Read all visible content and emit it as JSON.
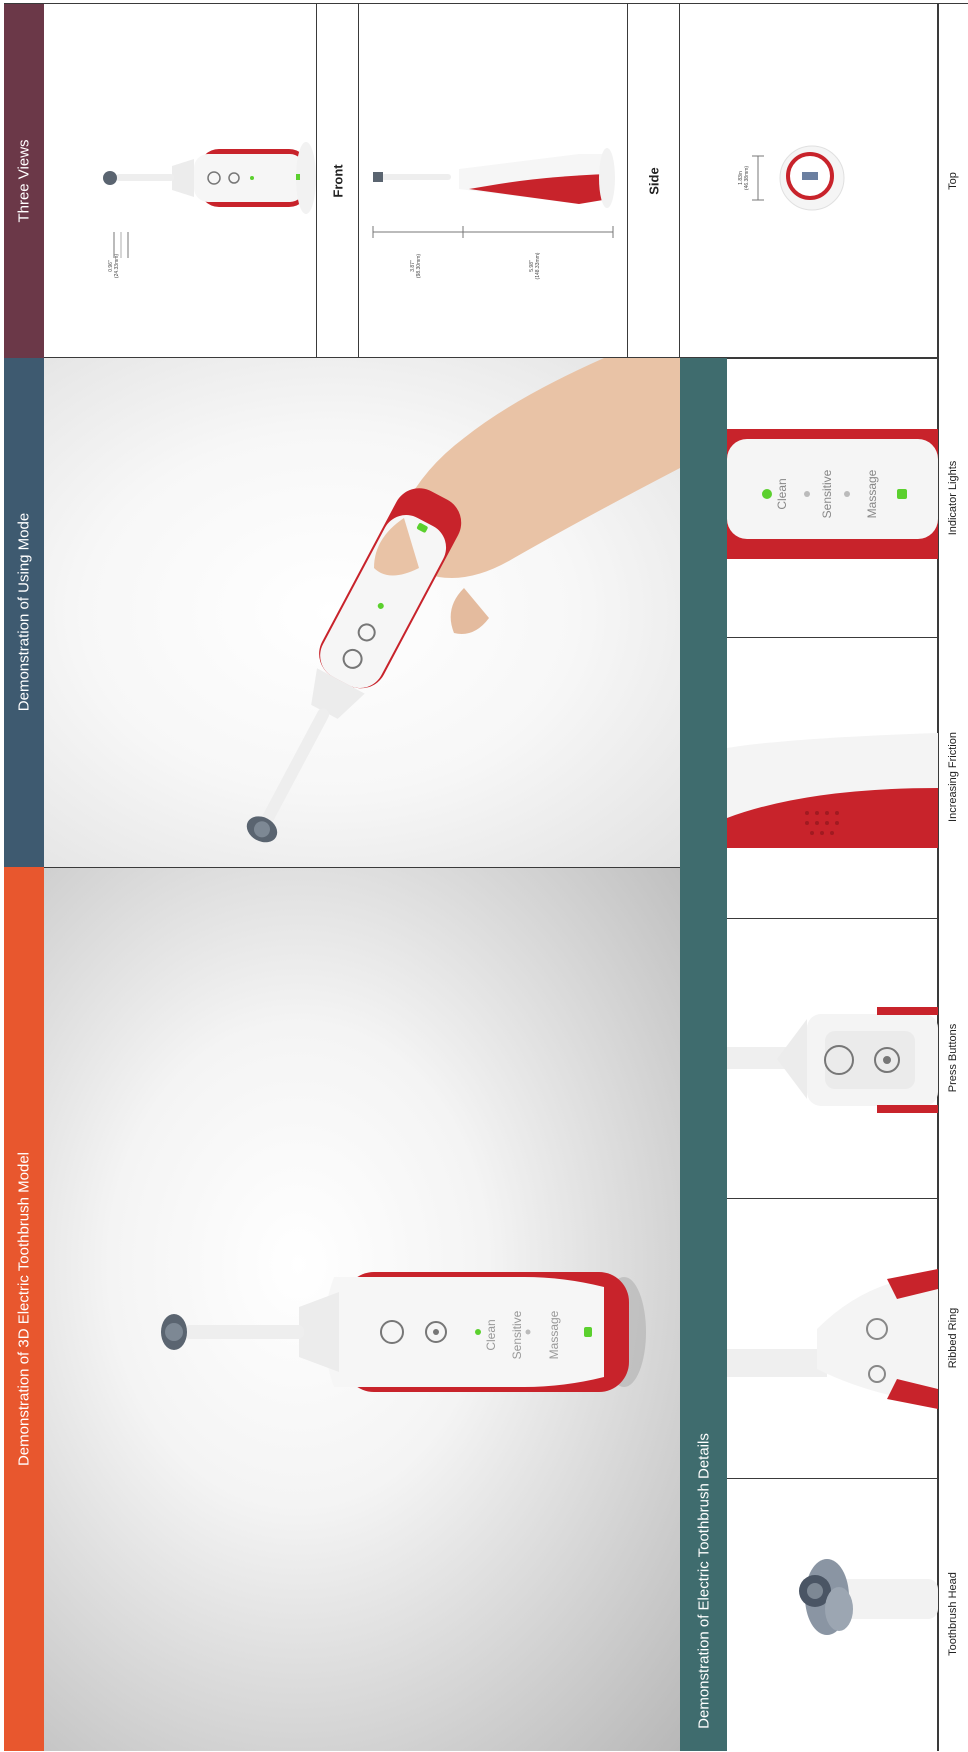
{
  "sections": {
    "model": {
      "title": "Demonstration of 3D Electric Toothbrush Model",
      "color": "#E8572E"
    },
    "using": {
      "title": "Demonstration of Using Mode",
      "color": "#3E5A70"
    },
    "three_views": {
      "title": "Three Views",
      "color": "#6B3848"
    },
    "details": {
      "title": "Demonstration of Electric Toothbrush Details",
      "color": "#3F6C6E"
    }
  },
  "views": {
    "front": "Front",
    "side": "Side",
    "top": "Top"
  },
  "dimensions": {
    "front_head": "0.96\"\n(24.33mm)",
    "side_upper": "3.87\"\n(98.30mm)",
    "side_lower": "5.98\"\n(148.33mm)",
    "top_width": "1.83in\n(46.38mm)"
  },
  "details": [
    {
      "label": "Toothbrush Head"
    },
    {
      "label": "Ribbed Ring"
    },
    {
      "label": "Press Buttons"
    },
    {
      "label": "Increasing Friction"
    },
    {
      "label": "Indicator Lights"
    }
  ],
  "brush": {
    "body_color": "#C8232B",
    "accent_color": "#5BD02E",
    "modes": [
      "Clean",
      "Sensitive",
      "Massage"
    ]
  }
}
